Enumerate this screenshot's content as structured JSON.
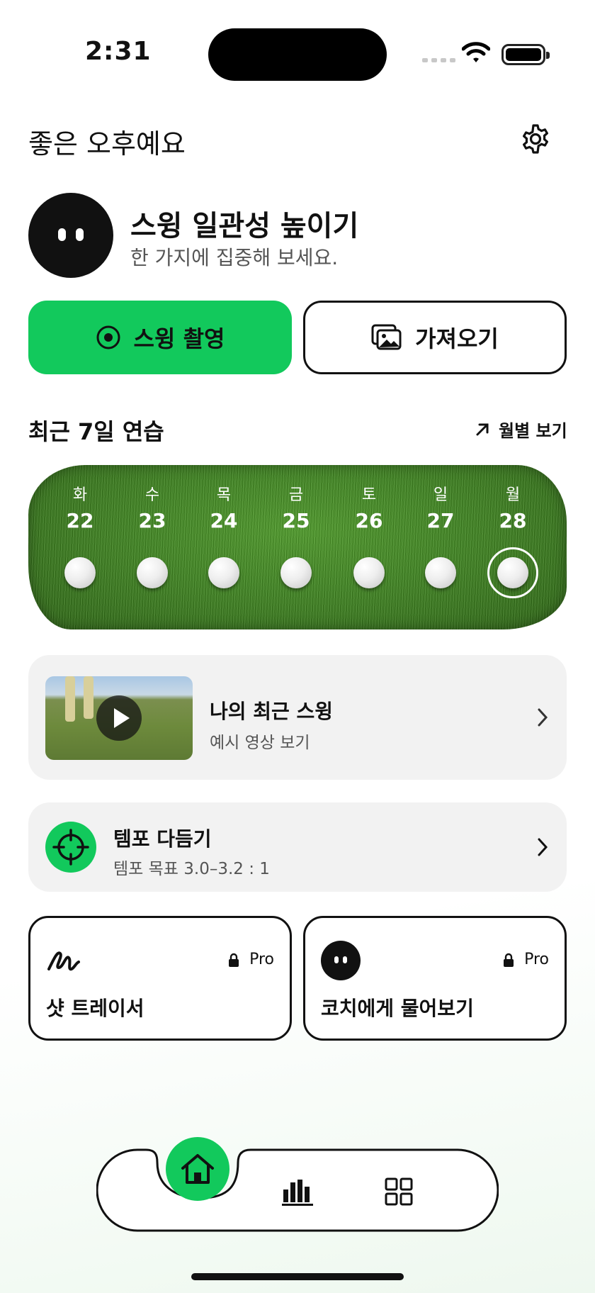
{
  "status_bar": {
    "time": "2:31"
  },
  "header": {
    "greeting": "좋은 오후예요"
  },
  "goal": {
    "title": "스윙 일관성 높이기",
    "subtitle": "한 가지에 집중해 보세요."
  },
  "actions": {
    "record_label": "스윙 촬영",
    "import_label": "가져오기"
  },
  "practice": {
    "title": "최근 7일 연습",
    "monthly_label": "월별 보기",
    "days": [
      {
        "dow": "화",
        "date": "22"
      },
      {
        "dow": "수",
        "date": "23"
      },
      {
        "dow": "목",
        "date": "24"
      },
      {
        "dow": "금",
        "date": "25"
      },
      {
        "dow": "토",
        "date": "26"
      },
      {
        "dow": "일",
        "date": "27"
      },
      {
        "dow": "월",
        "date": "28"
      }
    ],
    "selected_date": "28"
  },
  "recent_swing": {
    "title": "나의 최근 스윙",
    "subtitle": "예시 영상 보기"
  },
  "tempo": {
    "title": "템포 다듬기",
    "subtitle": "템포 목표 3.0–3.2 : 1"
  },
  "features": [
    {
      "label": "샷 트레이서",
      "badge": "Pro",
      "icon": "scribble-icon"
    },
    {
      "label": "코치에게 물어보기",
      "badge": "Pro",
      "icon": "coach-avatar-icon"
    }
  ],
  "tabs": [
    {
      "name": "home",
      "icon": "home-icon"
    },
    {
      "name": "stats",
      "icon": "bar-chart-icon"
    },
    {
      "name": "more",
      "icon": "grid-icon"
    }
  ],
  "colors": {
    "accent": "#12c95c",
    "dark": "#111111"
  }
}
